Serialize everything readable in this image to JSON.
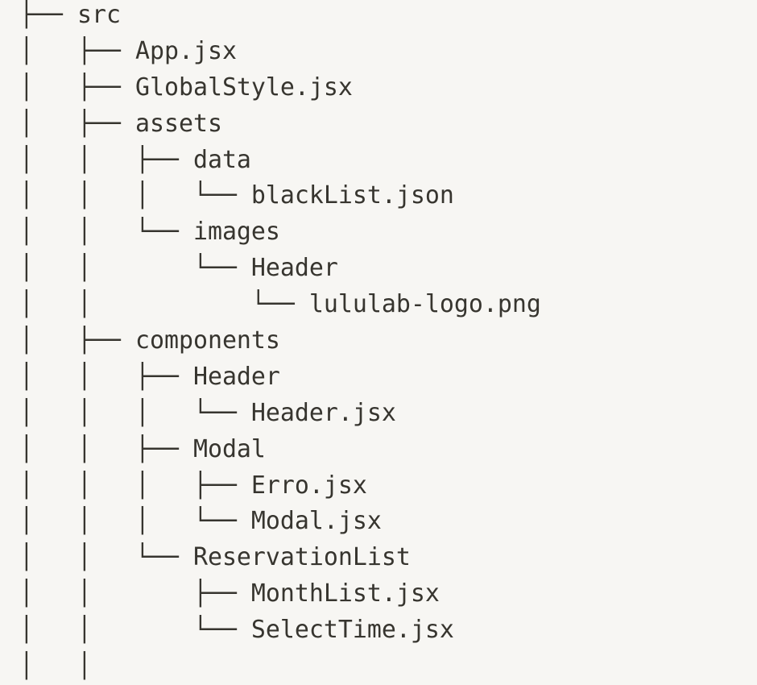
{
  "colors": {
    "background": "#f7f6f3",
    "text": "#37352f"
  },
  "tree_lines": [
    "├── src",
    "│   ├── App.jsx",
    "│   ├── GlobalStyle.jsx",
    "│   ├── assets",
    "│   │   ├── data",
    "│   │   │   └── blackList.json",
    "│   │   └── images",
    "│   │       └── Header",
    "│   │           └── lululab-logo.png",
    "│   ├── components",
    "│   │   ├── Header",
    "│   │   │   └── Header.jsx",
    "│   │   ├── Modal",
    "│   │   │   ├── Erro.jsx",
    "│   │   │   └── Modal.jsx",
    "│   │   └── ReservationList",
    "│   │       ├── MonthList.jsx",
    "│   │       └── SelectTime.jsx",
    "│   │"
  ]
}
